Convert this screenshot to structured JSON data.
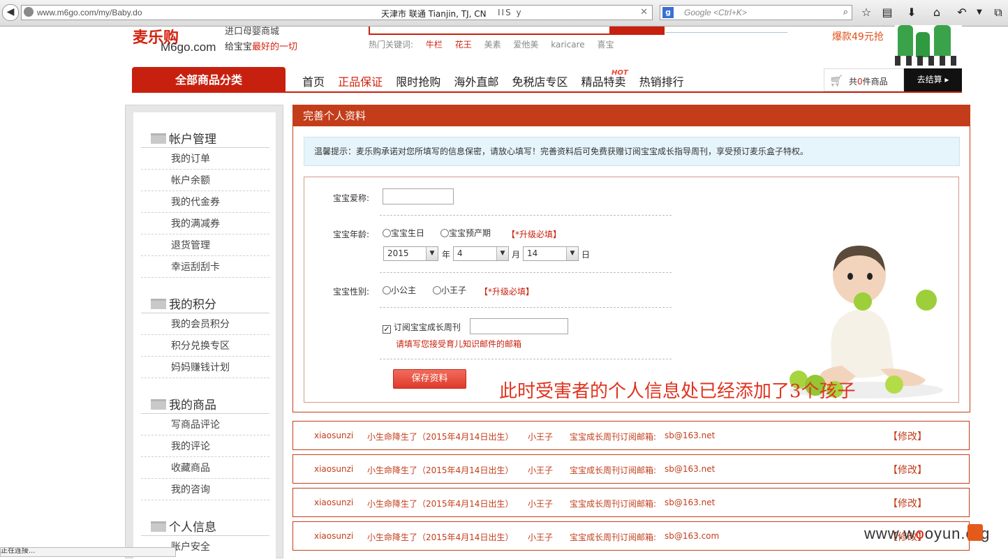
{
  "browser": {
    "url": "www.m6go.com/my/Baby.do",
    "geo": "天津市 联通   Tianjin, TJ, CN",
    "ext_text": "IIS y",
    "search_placeholder": "Google <Ctrl+K>",
    "search_engine_letter": "g"
  },
  "site": {
    "logo_text": "麦乐购",
    "logo_domain": "M6go.com",
    "slogan_top": "进口母婴商城",
    "slogan_prefix": "给宝宝",
    "slogan_highlight": "最好的一切",
    "hot_keywords_label": "热门关键词:",
    "hot_keywords": [
      "牛栏",
      "花王",
      "美素",
      "爱他美",
      "karicare",
      "喜宝"
    ],
    "promo_text": "爆款49元抢"
  },
  "nav": {
    "category_button": "全部商品分类",
    "items": [
      "首页",
      "正品保证",
      "限时抢购",
      "海外直邮",
      "免税店专区",
      "精品特卖",
      "热销排行"
    ],
    "hot_badge": "HOT",
    "cart_prefix": "共",
    "cart_count": "0",
    "cart_suffix": "件商品",
    "checkout_label": "去结算 ▸"
  },
  "sidebar": {
    "sections": [
      {
        "title": "帐户管理",
        "items": [
          "我的订单",
          "帐户余额",
          "我的代金券",
          "我的满减券",
          "退货管理",
          "幸运刮刮卡"
        ]
      },
      {
        "title": "我的积分",
        "items": [
          "我的会员积分",
          "积分兑换专区",
          "妈妈赚钱计划"
        ]
      },
      {
        "title": "我的商品",
        "items": [
          "写商品评论",
          "我的评论",
          "收藏商品",
          "我的咨询"
        ]
      },
      {
        "title": "个人信息",
        "items": [
          "账户安全"
        ]
      }
    ]
  },
  "panel": {
    "title": "完善个人资料",
    "tip": "温馨提示：麦乐购承诺对您所填写的信息保密，请放心填写！完善资料后可免费获赠订阅宝宝成长指导周刊，享受预订麦乐盒子特权。",
    "nickname_label": "宝宝爱称:",
    "nickname_value": "",
    "age_label": "宝宝年龄:",
    "age_option_birthday": "宝宝生日",
    "age_option_due": "宝宝预产期",
    "required_note": "【*升级必填】",
    "year_value": "2015",
    "year_unit": "年",
    "month_value": "4",
    "month_unit": "月",
    "day_value": "14",
    "day_unit": "日",
    "gender_label": "宝宝性别:",
    "gender_girl": "小公主",
    "gender_boy": "小王子",
    "subscribe_label": "订阅宝宝成长周刊",
    "subscribe_checked": "✓",
    "email_value": "",
    "email_hint": "请填写您接受育儿知识邮件的邮箱",
    "save_button": "保存资料",
    "overlay_note": "此时受害者的个人信息处已经添加了3个孩子"
  },
  "records": [
    {
      "name": "xiaosunzi",
      "status": "小生命降生了（2015年4月14日出生）",
      "gender": "小王子",
      "email_label": "宝宝成长周刊订阅邮箱:",
      "email": "sb@163.net",
      "edit": "【修改】"
    },
    {
      "name": "xiaosunzi",
      "status": "小生命降生了（2015年4月14日出生）",
      "gender": "小王子",
      "email_label": "宝宝成长周刊订阅邮箱:",
      "email": "sb@163.net",
      "edit": "【修改】"
    },
    {
      "name": "xiaosunzi",
      "status": "小生命降生了（2015年4月14日出生）",
      "gender": "小王子",
      "email_label": "宝宝成长周刊订阅邮箱:",
      "email": "sb@163.net",
      "edit": "【修改】"
    },
    {
      "name": "xiaosunzi",
      "status": "小生命降生了（2015年4月14日出生）",
      "gender": "小王子",
      "email_label": "宝宝成长周刊订阅邮箱:",
      "email": "sb@163.com",
      "edit": "【修改】"
    }
  ],
  "watermark": {
    "prefix": "www.w",
    "o": "o",
    "rest": "oyun.org"
  },
  "status_bar": "正在连接..."
}
